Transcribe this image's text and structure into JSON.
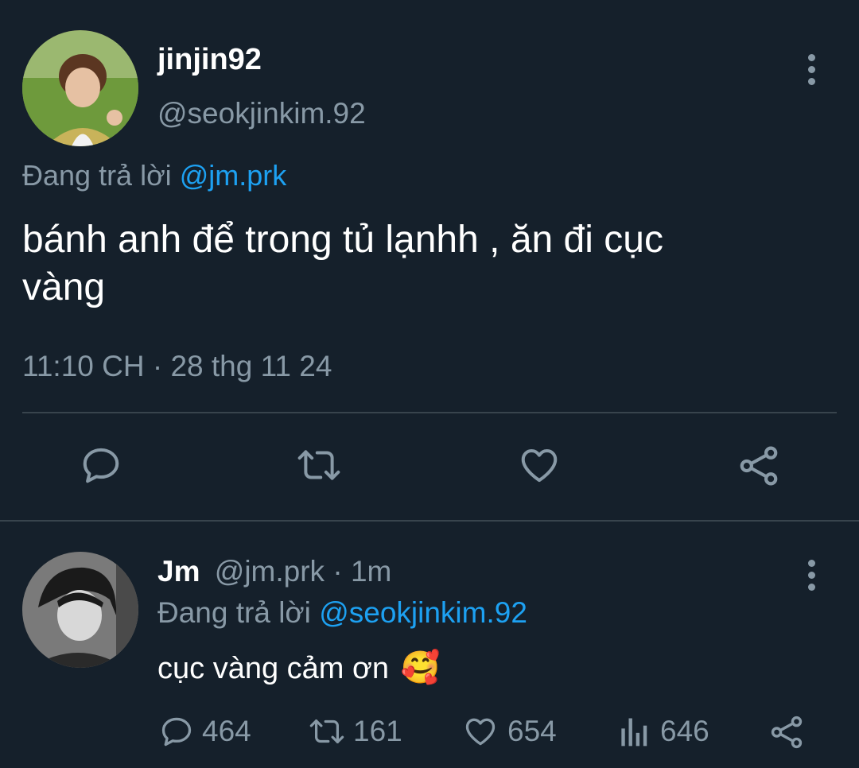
{
  "tweet": {
    "display_name": "jinjin92",
    "handle": "@seokjinkim.92",
    "replying_prefix": "Đang trả lời",
    "replying_to": "@jm.prk",
    "text_line1": "bánh anh để trong tủ lạnhh , ăn đi cục",
    "text_line2": "vàng",
    "timestamp": "11:10 CH · 28 thg 11 24",
    "actions": [
      "reply-icon",
      "retweet-icon",
      "like-icon",
      "share-icon"
    ]
  },
  "reply": {
    "display_name": "Jm",
    "handle": "@jm.prk",
    "separator": "·",
    "time": "1m",
    "replying_prefix": "Đang trả lời",
    "replying_to": "@seokjinkim.92",
    "text": "cục vàng cảm ơn",
    "emoji": "🥰",
    "stats": {
      "replies": "464",
      "retweets": "161",
      "likes": "654",
      "views": "646"
    }
  },
  "colors": {
    "background": "#15202b",
    "muted": "#8899a6",
    "link": "#1da1f2",
    "divider": "#38444d"
  }
}
